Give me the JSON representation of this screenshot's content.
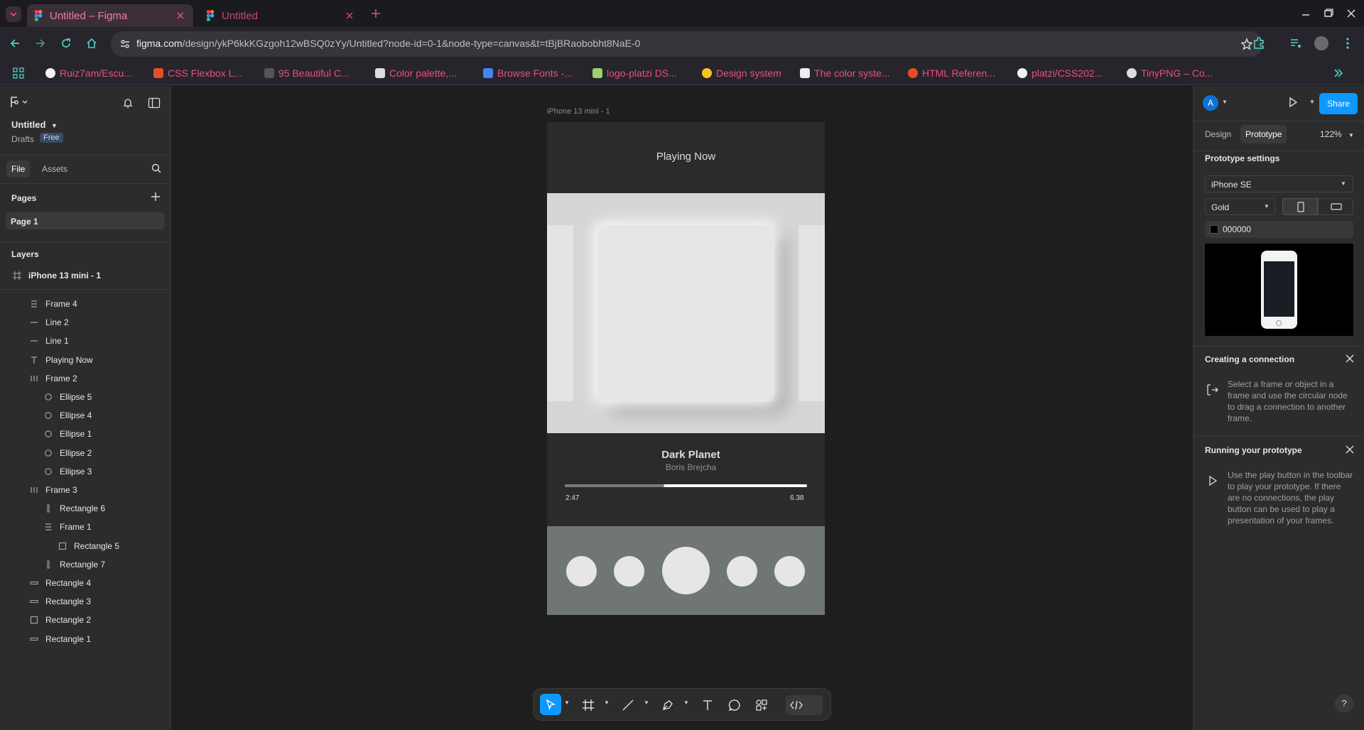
{
  "browser": {
    "tabs": [
      {
        "title": "Untitled – Figma",
        "active": true
      },
      {
        "title": "Untitled",
        "active": false
      }
    ],
    "url_host": "figma.com",
    "url_path": "/design/ykP6kkKGzgoh12wBSQ0zYy/Untitled?node-id=0-1&node-type=canvas&t=tBjBRaobobht8NaE-0",
    "bookmarks": [
      "Ruiz7am/Escu...",
      "CSS Flexbox L...",
      "95 Beautiful C...",
      "Color palette,...",
      "Browse Fonts -...",
      "logo-platzi DS...",
      "Design system",
      "The color syste...",
      "HTML Referen...",
      "platzi/CSS202...",
      "TinyPNG – Co..."
    ]
  },
  "left_panel": {
    "file_name": "Untitled",
    "drafts": "Drafts",
    "plan_badge": "Free",
    "tab_file": "File",
    "tab_assets": "Assets",
    "pages_heading": "Pages",
    "pages": [
      "Page 1"
    ],
    "layers_heading": "Layers",
    "root_layer": "iPhone 13 mini - 1",
    "layers": [
      {
        "name": "Frame 4",
        "icon": "autolayout-vertical-icon",
        "level": 1
      },
      {
        "name": "Line 2",
        "icon": "line-icon",
        "level": 1
      },
      {
        "name": "Line 1",
        "icon": "line-icon",
        "level": 1
      },
      {
        "name": "Playing Now",
        "icon": "text-icon",
        "level": 1
      },
      {
        "name": "Frame 2",
        "icon": "autolayout-horizontal-icon",
        "level": 1
      },
      {
        "name": "Ellipse 5",
        "icon": "ellipse-icon",
        "level": 2
      },
      {
        "name": "Ellipse 4",
        "icon": "ellipse-icon",
        "level": 2
      },
      {
        "name": "Ellipse 1",
        "icon": "ellipse-icon",
        "level": 2
      },
      {
        "name": "Ellipse 2",
        "icon": "ellipse-icon",
        "level": 2
      },
      {
        "name": "Ellipse 3",
        "icon": "ellipse-icon",
        "level": 2
      },
      {
        "name": "Frame 3",
        "icon": "autolayout-horizontal-icon",
        "level": 1
      },
      {
        "name": "Rectangle 6",
        "icon": "rectangle-thin-icon",
        "level": 2
      },
      {
        "name": "Frame 1",
        "icon": "autolayout-vertical-icon",
        "level": 2
      },
      {
        "name": "Rectangle 5",
        "icon": "rectangle-icon",
        "level": 3
      },
      {
        "name": "Rectangle 7",
        "icon": "rectangle-thin-icon",
        "level": 2
      },
      {
        "name": "Rectangle 4",
        "icon": "rectangle-wide-icon",
        "level": 1
      },
      {
        "name": "Rectangle 3",
        "icon": "rectangle-wide-icon",
        "level": 1
      },
      {
        "name": "Rectangle 2",
        "icon": "rectangle-icon",
        "level": 1
      },
      {
        "name": "Rectangle 1",
        "icon": "rectangle-wide-icon",
        "level": 1
      }
    ]
  },
  "canvas": {
    "frame_label": "iPhone 13 mini - 1",
    "header_title": "Playing Now",
    "song_title": "Dark Planet",
    "artist": "Boris Brejcha",
    "elapsed": "2:47",
    "duration": "6.38",
    "progress_fraction": 0.41
  },
  "right_panel": {
    "avatar_letter": "A",
    "share_label": "Share",
    "tab_design": "Design",
    "tab_prototype": "Prototype",
    "zoom": "122%",
    "prototype_settings": "Prototype settings",
    "device": "iPhone SE",
    "device_color": "Gold",
    "background_hex": "000000",
    "connection_heading": "Creating a connection",
    "connection_text": "Select a frame or object in a frame and use the circular node to drag a connection to another frame.",
    "running_heading": "Running your prototype",
    "running_text": "Use the play button in the toolbar to play your prototype. If there are no connections, the play button can be used to play a presentation of your frames."
  },
  "colors": {
    "figma_blue": "#0d99ff",
    "bookmark_pink": "#e94f7e"
  }
}
